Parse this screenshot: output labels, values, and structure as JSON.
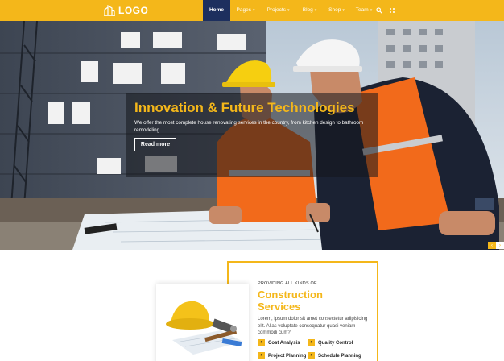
{
  "header": {
    "logo_text": "LOGO",
    "nav": [
      {
        "label": "Home",
        "active": true,
        "dropdown": false
      },
      {
        "label": "Pages",
        "active": false,
        "dropdown": true
      },
      {
        "label": "Projects",
        "active": false,
        "dropdown": true
      },
      {
        "label": "Blog",
        "active": false,
        "dropdown": true
      },
      {
        "label": "Shop",
        "active": false,
        "dropdown": true
      },
      {
        "label": "Team",
        "active": false,
        "dropdown": true
      }
    ],
    "tools": [
      "search-icon",
      "menu-dots-icon"
    ]
  },
  "hero": {
    "title": "Innovation & Future Technologies",
    "description": "We offer the most complete house renovating services in the country, from kitchen design to bathroom remodeling.",
    "button_label": "Read more",
    "prev_arrow": "‹",
    "next_arrow": "›"
  },
  "services": {
    "kicker": "PROVIDING ALL KINDS OF",
    "title_line1": "Construction",
    "title_line2": "Services",
    "description": "Lorem, ipsum dolor sit amet consectetur adipisicing elit. Alias voluptate consequatur quasi veniam commodi cum?",
    "items": [
      "Cost Analysis",
      "Quality Control",
      "Project Planning",
      "Schedule Planning"
    ]
  },
  "colors": {
    "brand": "#f4b71a",
    "nav_active": "#1d2f5e"
  }
}
